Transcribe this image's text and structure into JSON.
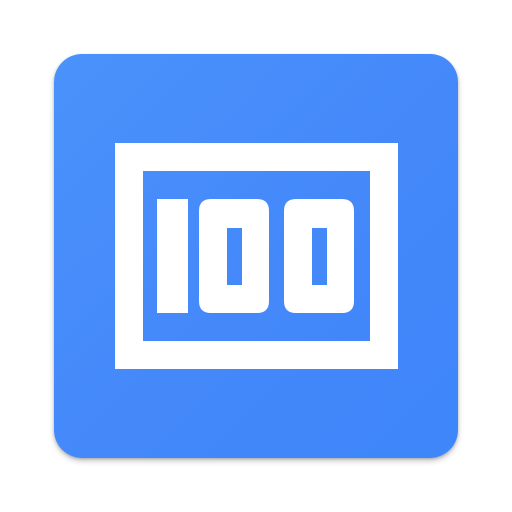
{
  "icon": {
    "name": "score-counter-app-icon",
    "number_text": "100",
    "colors": {
      "tile": "#4488fa",
      "foreground": "#ffffff"
    }
  }
}
